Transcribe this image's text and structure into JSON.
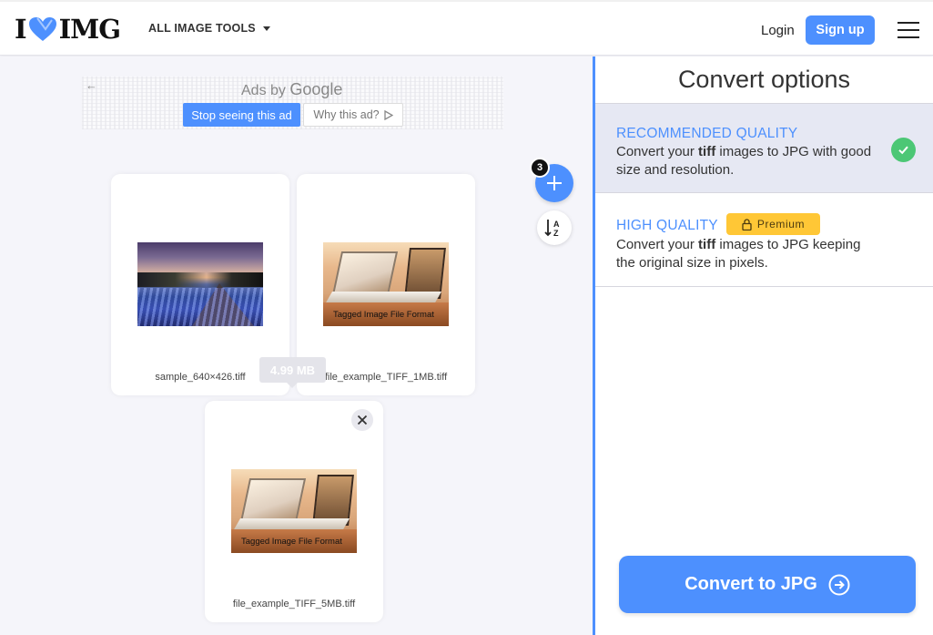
{
  "header": {
    "logo_left": "I",
    "logo_right": "IMG",
    "tools_label": "ALL IMAGE TOOLS",
    "login_label": "Login",
    "signup_label": "Sign up"
  },
  "ad": {
    "title_prefix": "Ads by",
    "title_brand": "Google",
    "stop_label": "Stop seeing this ad",
    "why_label": "Why this ad?"
  },
  "files": {
    "count": "3",
    "size_tooltip": "4.99 MB",
    "items": [
      {
        "name": "sample_640×426.tiff"
      },
      {
        "name": "file_example_TIFF_1MB.tiff",
        "caption": "Tagged Image File Format"
      },
      {
        "name": "file_example_TIFF_5MB.tiff",
        "caption": "Tagged Image File Format"
      }
    ]
  },
  "sidebar": {
    "title": "Convert options",
    "options": [
      {
        "label": "RECOMMENDED QUALITY",
        "desc_pre": "Convert your ",
        "desc_bold": "tiff",
        "desc_post": " images to JPG with good size and resolution.",
        "selected": true
      },
      {
        "label": "HIGH QUALITY",
        "badge": "Premium",
        "desc_pre": "Convert your ",
        "desc_bold": "tiff",
        "desc_post": " images to JPG keeping the original size in pixels.",
        "selected": false
      }
    ],
    "convert_label": "Convert to JPG"
  },
  "colors": {
    "accent": "#4d90fe",
    "success": "#4cc775",
    "premium": "#ffc736"
  }
}
